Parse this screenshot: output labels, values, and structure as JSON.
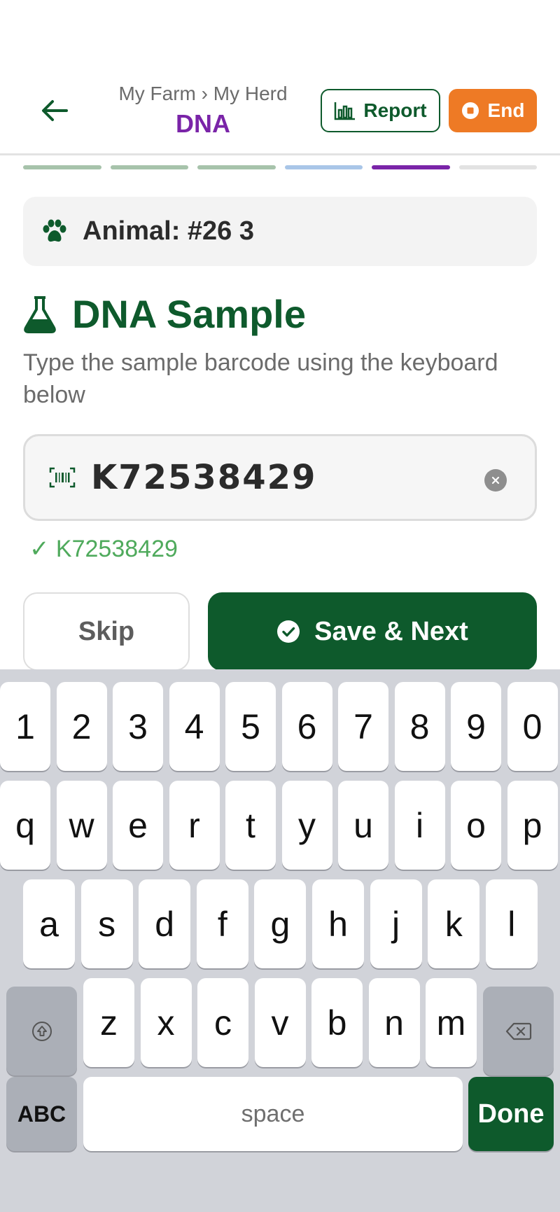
{
  "header": {
    "breadcrumb": "My Farm › My Herd",
    "title": "DNA",
    "report_label": "Report",
    "end_label": "End"
  },
  "progress": {
    "steps": [
      "complete",
      "complete",
      "complete",
      "upcoming-blue",
      "current",
      "upcoming"
    ]
  },
  "animal": {
    "label": "Animal: #26 3"
  },
  "section": {
    "title": "DNA Sample",
    "instructions": "Type the sample barcode using the keyboard below"
  },
  "barcode": {
    "value": "K72538429",
    "validation": "✓ K72538429"
  },
  "actions": {
    "skip_label": "Skip",
    "save_label": "Save & Next"
  },
  "keyboard": {
    "row1": [
      "1",
      "2",
      "3",
      "4",
      "5",
      "6",
      "7",
      "8",
      "9",
      "0"
    ],
    "row2": [
      "q",
      "w",
      "e",
      "r",
      "t",
      "y",
      "u",
      "i",
      "o",
      "p"
    ],
    "row3": [
      "a",
      "s",
      "d",
      "f",
      "g",
      "h",
      "j",
      "k",
      "l"
    ],
    "row4": [
      "z",
      "x",
      "c",
      "v",
      "b",
      "n",
      "m"
    ],
    "abc_label": "ABC",
    "space_label": "space",
    "done_label": "Done"
  },
  "colors": {
    "primary_green": "#0e5a2c",
    "accent_purple": "#7a24a8",
    "end_orange": "#ee7a25",
    "valid_green": "#4faa5c"
  },
  "icons": {
    "back": "arrow-left-icon",
    "report": "bar-chart-icon",
    "end": "stop-icon",
    "animal": "paw-icon",
    "section": "flask-icon",
    "barcode": "barcode-icon",
    "clear": "clear-icon",
    "save": "check-circle-icon",
    "shift": "shift-icon",
    "backspace": "backspace-icon"
  }
}
